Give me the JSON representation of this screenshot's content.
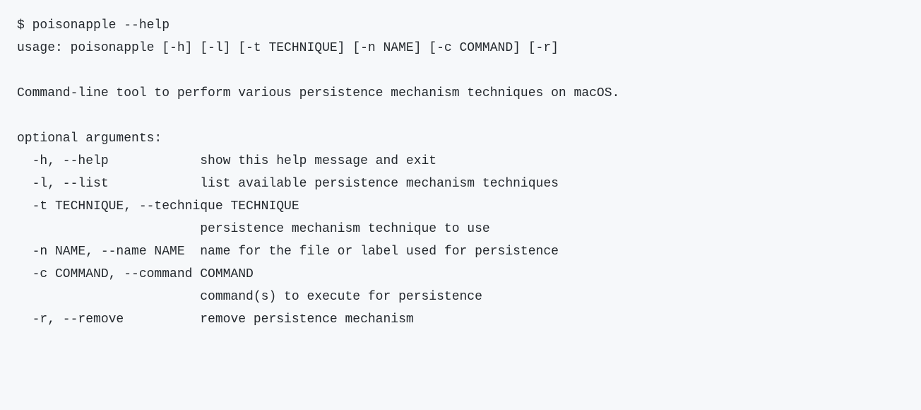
{
  "cli": {
    "command_line": "$ poisonapple --help",
    "usage_line": "usage: poisonapple [-h] [-l] [-t TECHNIQUE] [-n NAME] [-c COMMAND] [-r]",
    "description": "Command-line tool to perform various persistence mechanism techniques on macOS.",
    "optional_header": "optional arguments:",
    "arg_help": "  -h, --help            show this help message and exit",
    "arg_list": "  -l, --list            list available persistence mechanism techniques",
    "arg_technique_line1": "  -t TECHNIQUE, --technique TECHNIQUE",
    "arg_technique_line2": "                        persistence mechanism technique to use",
    "arg_name": "  -n NAME, --name NAME  name for the file or label used for persistence",
    "arg_command_line1": "  -c COMMAND, --command COMMAND",
    "arg_command_line2": "                        command(s) to execute for persistence",
    "arg_remove": "  -r, --remove          remove persistence mechanism"
  }
}
